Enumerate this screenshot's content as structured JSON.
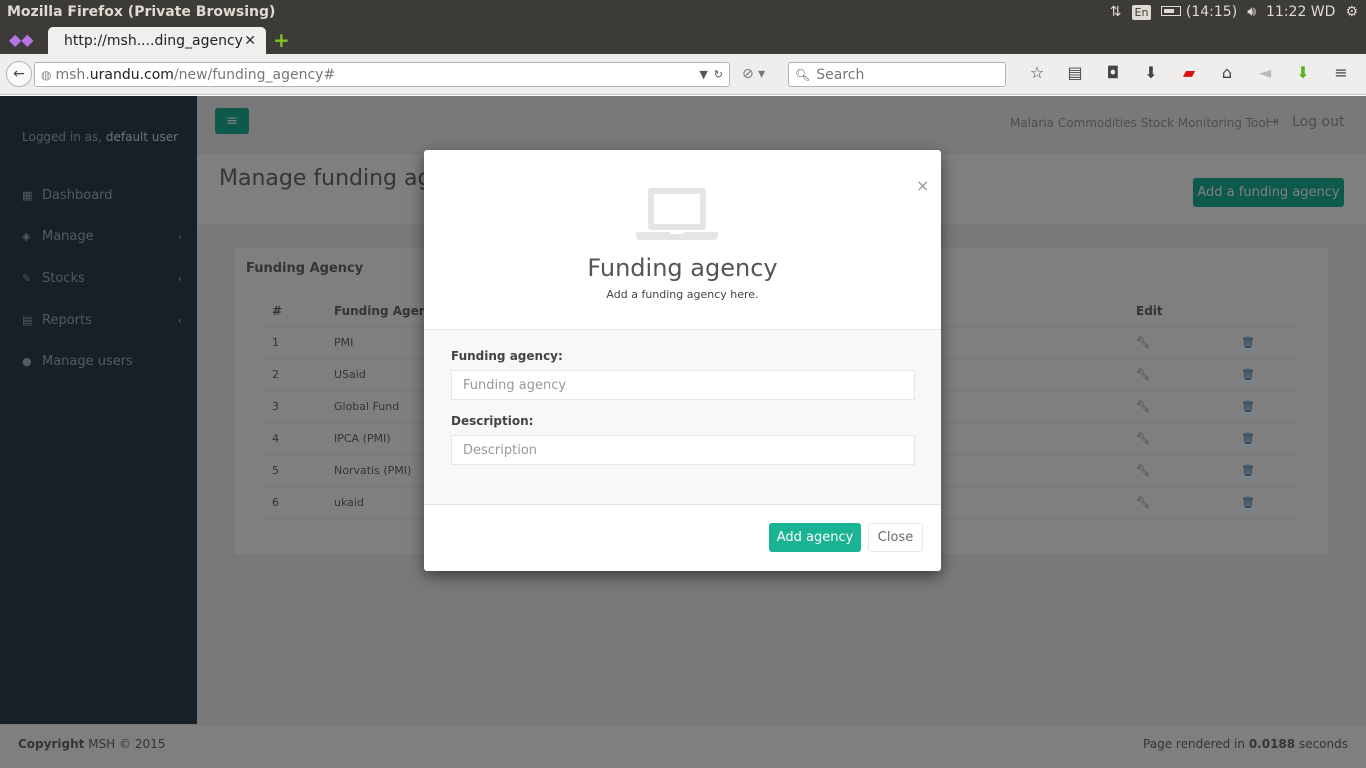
{
  "os": {
    "window_title": "Mozilla Firefox (Private Browsing)",
    "lang": "En",
    "battery": "(14:15)",
    "clock": "11:22 WD"
  },
  "browser": {
    "tab_label": "http://msh....ding_agency",
    "url_prefix": "msh.",
    "url_domain": "urandu.com",
    "url_path": "/new/funding_agency#",
    "search_placeholder": "Search"
  },
  "sidebar": {
    "logged_prefix": "Logged in as, ",
    "user": "default user",
    "items": [
      {
        "label": "Dashboard",
        "icon": "dashboard-icon",
        "glyph": "▦",
        "arrow": ""
      },
      {
        "label": "Manage",
        "icon": "manage-icon",
        "glyph": "◈",
        "arrow": "‹"
      },
      {
        "label": "Stocks",
        "icon": "edit-icon",
        "glyph": "✎",
        "arrow": "‹"
      },
      {
        "label": "Reports",
        "icon": "bar-chart-icon",
        "glyph": "▤",
        "arrow": "‹"
      },
      {
        "label": "Manage users",
        "icon": "user-icon",
        "glyph": "●",
        "arrow": ""
      }
    ]
  },
  "topnav": {
    "app_name": "Malaria Commodities Stock Monitoring Tool",
    "logout": "Log out"
  },
  "page": {
    "heading": "Manage funding agencies",
    "add_button": "Add a funding agency",
    "panel_title": "Funding Agency",
    "columns": {
      "num": "#",
      "name": "Funding Agency",
      "edit": "Edit"
    },
    "rows": [
      {
        "num": "1",
        "name": "PMI"
      },
      {
        "num": "2",
        "name": "USaid"
      },
      {
        "num": "3",
        "name": "Global Fund"
      },
      {
        "num": "4",
        "name": "IPCA (PMI)"
      },
      {
        "num": "5",
        "name": "Norvatis (PMI)"
      },
      {
        "num": "6",
        "name": "ukaid"
      }
    ]
  },
  "footer": {
    "copyright_strong": "Copyright",
    "copyright_rest": " MSH © 2015",
    "rendered_prefix": "Page rendered in ",
    "rendered_time": "0.0188",
    "rendered_suffix": " seconds"
  },
  "modal": {
    "close_x": "×",
    "title": "Funding agency",
    "subtitle": "Add a funding agency here.",
    "agency_label": "Funding agency:",
    "agency_placeholder": "Funding agency",
    "description_label": "Description:",
    "description_placeholder": "Description",
    "add_button": "Add agency",
    "close_button": "Close"
  },
  "colors": {
    "accent": "#1ab394",
    "sidebar": "#2f4050"
  }
}
